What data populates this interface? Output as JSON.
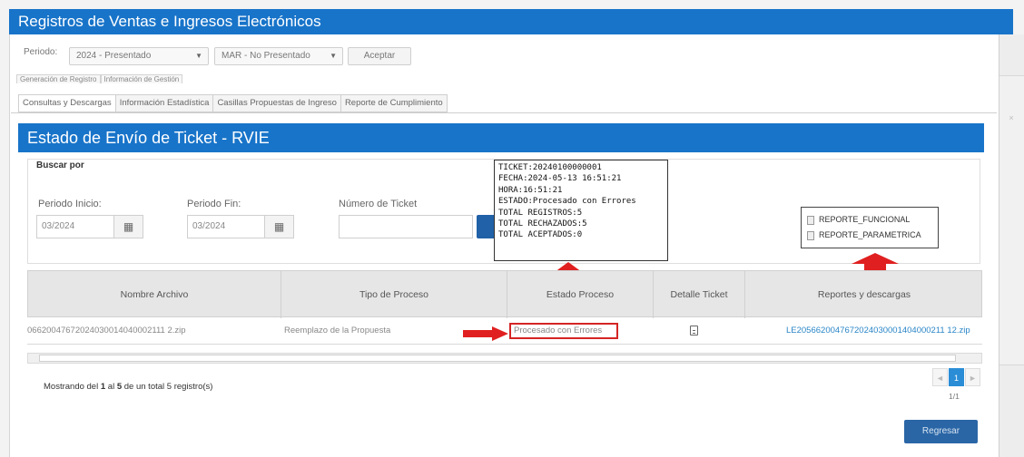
{
  "app": {
    "title": "Registros de Ventas e Ingresos Electrónicos"
  },
  "period_bar": {
    "label": "Periodo:",
    "year_select": "2024 - Presentado",
    "month_select": "MAR - No Presentado",
    "accept_label": "Aceptar"
  },
  "top_tabs": [
    "Generación de Registro",
    "Información de Gestión"
  ],
  "sub_tabs": [
    "Consultas y Descargas",
    "Información Estadística",
    "Casillas Propuestas de Ingreso",
    "Reporte de Cumplimiento"
  ],
  "section": {
    "title": "Estado de Envío de Ticket - RVIE"
  },
  "search": {
    "legend": "Buscar por",
    "periodo_inicio_label": "Periodo Inicio:",
    "periodo_inicio_value": "03/2024",
    "periodo_fin_label": "Periodo Fin:",
    "periodo_fin_value": "03/2024",
    "ticket_label": "Número de Ticket",
    "ticket_value": ""
  },
  "ticket_popup": [
    "TICKET:20240100000001",
    "FECHA:2024-05-13 16:51:21",
    "HORA:16:51:21",
    "ESTADO:Procesado con Errores",
    "TOTAL REGISTROS:5",
    "TOTAL RECHAZADOS:5",
    "TOTAL ACEPTADOS:0"
  ],
  "reports_popup": [
    "REPORTE_FUNCIONAL",
    "REPORTE_PARAMETRICA"
  ],
  "table": {
    "columns": [
      "Nombre Archivo",
      "Tipo de Proceso",
      "Estado Proceso",
      "Detalle Ticket",
      "Reportes y descargas"
    ],
    "rows": [
      {
        "archivo": "06620047672024030014040002111 2.zip",
        "tipo": "Reemplazo de la Propuesta",
        "estado": "Procesado con Errores",
        "reporte": "LE2056620047672024030001404000211 12.zip"
      }
    ]
  },
  "footer": {
    "showing_prefix": "Mostrando del ",
    "from": "1",
    "mid1": " al ",
    "to": "5",
    "mid2": " de un total 5 registro(s)",
    "page_current": "1",
    "page_info": "1/1",
    "back_label": "Regresar"
  },
  "colors": {
    "primary": "#1874c9",
    "highlight": "#d42525",
    "link": "#2a86c7"
  },
  "icons": [
    "calendar-icon",
    "search-icon",
    "document-icon",
    "arrow-up-icon",
    "arrow-right-icon"
  ]
}
